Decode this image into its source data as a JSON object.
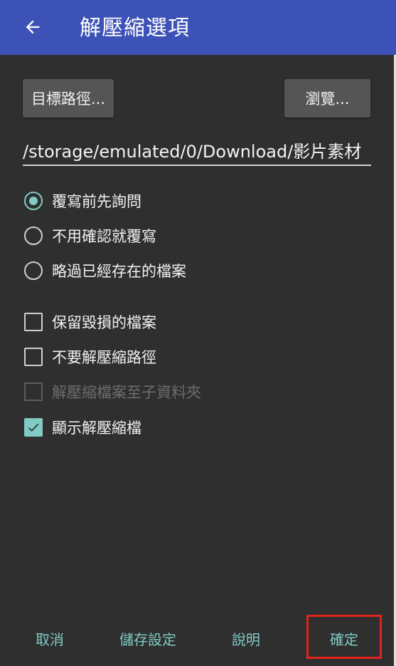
{
  "appbar": {
    "title": "解壓縮選項",
    "back_icon": "arrow-left-icon"
  },
  "target_button": "目標路徑...",
  "browse_button": "瀏覽...",
  "path_value": "/storage/emulated/0/Download/影片素材",
  "overwrite_options": [
    {
      "label": "覆寫前先詢問",
      "selected": true
    },
    {
      "label": "不用確認就覆寫",
      "selected": false
    },
    {
      "label": "略過已經存在的檔案",
      "selected": false
    }
  ],
  "checkbox_options": [
    {
      "label": "保留毀損的檔案",
      "checked": false,
      "enabled": true
    },
    {
      "label": "不要解壓縮路徑",
      "checked": false,
      "enabled": true
    },
    {
      "label": "解壓縮檔案至子資料夾",
      "checked": false,
      "enabled": false
    },
    {
      "label": "顯示解壓縮檔",
      "checked": true,
      "enabled": true
    }
  ],
  "footer": {
    "cancel": "取消",
    "save_settings": "儲存設定",
    "help": "說明",
    "ok": "確定"
  },
  "colors": {
    "appbar": "#3d52b7",
    "accent": "#80cbc4",
    "background": "#2f2f2f",
    "highlight": "#e3231b"
  }
}
